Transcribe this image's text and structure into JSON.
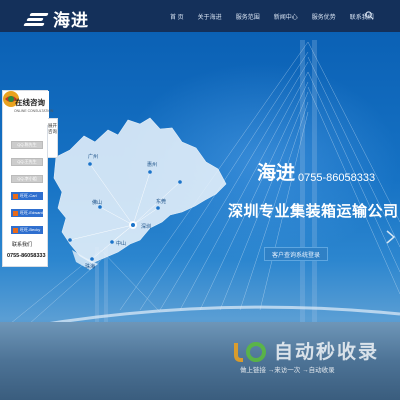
{
  "header": {
    "logo_text": "海进",
    "nav": [
      "首 页",
      "关于海进",
      "服务范围",
      "新闻中心",
      "服务优势",
      "联系我们"
    ],
    "search_icon": "search-icon"
  },
  "hero": {
    "title": "海进",
    "phone": "0755-86058333",
    "subtitle": "深圳专业集装箱运输公司",
    "query_button": "客户查询系统登录"
  },
  "map_cities": [
    "广州",
    "惠州",
    "佛山",
    "东莞",
    "深圳",
    "中山",
    "珠海"
  ],
  "sidebar": {
    "title": "在线咨询",
    "subtitle": "ONLINE CONSULTATION",
    "collapse_label": "展开咨询",
    "qq_items": [
      "QQ-陈先生",
      "QQ-王先生",
      "QQ-李小姐"
    ],
    "ww_items": [
      "旺旺-Carl",
      "旺旺-Edward",
      "旺旺-Becky"
    ],
    "contact_label": "联系我们",
    "contact_phone": "0755-86058333"
  },
  "watermark": {
    "brand": "自动秒收录",
    "tagline": "做上链接 →来访一次 →自动收录"
  }
}
